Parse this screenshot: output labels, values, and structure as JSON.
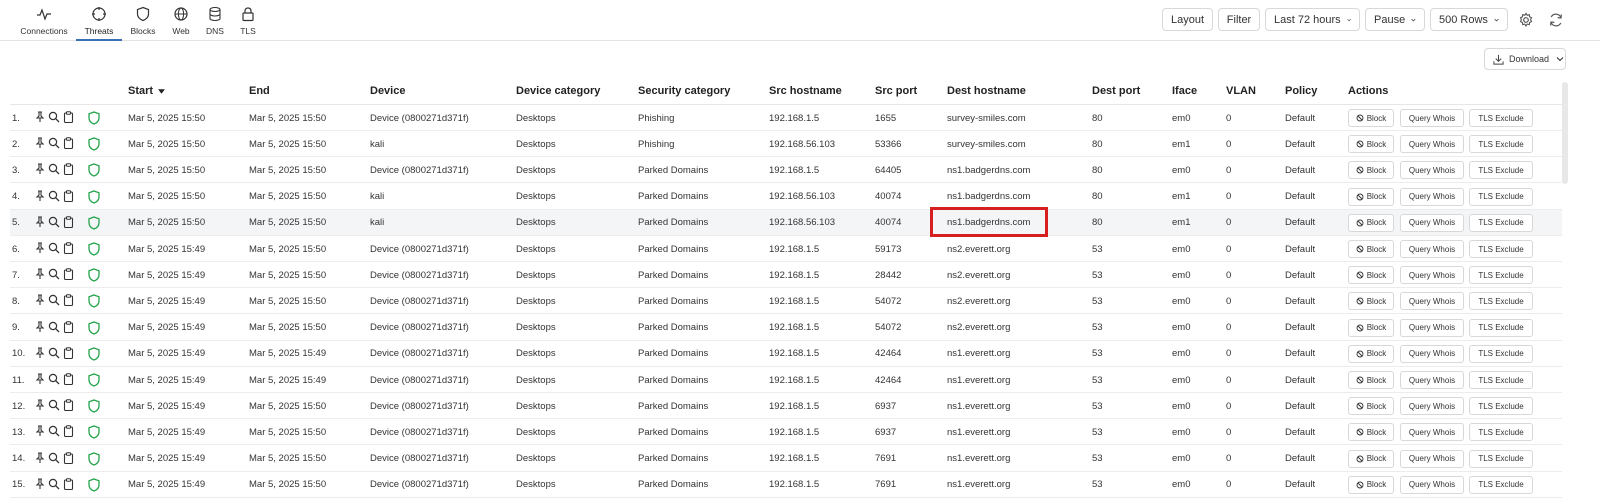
{
  "nav": {
    "tabs": [
      {
        "label": "Connections",
        "icon": "activity-icon"
      },
      {
        "label": "Threats",
        "icon": "crosshair-icon"
      },
      {
        "label": "Blocks",
        "icon": "shield-icon"
      },
      {
        "label": "Web",
        "icon": "globe-icon"
      },
      {
        "label": "DNS",
        "icon": "database-icon"
      },
      {
        "label": "TLS",
        "icon": "lock-icon"
      }
    ],
    "active": "Threats"
  },
  "toolbar": {
    "layout": "Layout",
    "filter": "Filter",
    "range": "Last 72 hours",
    "pause": "Pause",
    "rows": "500 Rows",
    "download": "Download"
  },
  "columns": [
    "Start",
    "End",
    "Device",
    "Device category",
    "Security category",
    "Src hostname",
    "Src port",
    "Dest hostname",
    "Dest port",
    "Iface",
    "VLAN",
    "Policy",
    "Actions"
  ],
  "actions": {
    "block": "Block",
    "whois": "Query Whois",
    "tls": "TLS Exclude"
  },
  "rows": [
    {
      "idx": "1.",
      "start": "Mar 5, 2025 15:50",
      "end": "Mar 5, 2025 15:50",
      "device": "Device (0800271d371f)",
      "devcat": "Desktops",
      "seccat": "Phishing",
      "src": "192.168.1.5",
      "sport": "1655",
      "dest": "survey-smiles.com",
      "dport": "80",
      "iface": "em0",
      "vlan": "0",
      "policy": "Default"
    },
    {
      "idx": "2.",
      "start": "Mar 5, 2025 15:50",
      "end": "Mar 5, 2025 15:50",
      "device": "kali",
      "devcat": "Desktops",
      "seccat": "Phishing",
      "src": "192.168.56.103",
      "sport": "53366",
      "dest": "survey-smiles.com",
      "dport": "80",
      "iface": "em1",
      "vlan": "0",
      "policy": "Default"
    },
    {
      "idx": "3.",
      "start": "Mar 5, 2025 15:50",
      "end": "Mar 5, 2025 15:50",
      "device": "Device (0800271d371f)",
      "devcat": "Desktops",
      "seccat": "Parked Domains",
      "src": "192.168.1.5",
      "sport": "64405",
      "dest": "ns1.badgerdns.com",
      "dport": "80",
      "iface": "em0",
      "vlan": "0",
      "policy": "Default"
    },
    {
      "idx": "4.",
      "start": "Mar 5, 2025 15:50",
      "end": "Mar 5, 2025 15:50",
      "device": "kali",
      "devcat": "Desktops",
      "seccat": "Parked Domains",
      "src": "192.168.56.103",
      "sport": "40074",
      "dest": "ns1.badgerdns.com",
      "dport": "80",
      "iface": "em1",
      "vlan": "0",
      "policy": "Default"
    },
    {
      "idx": "5.",
      "start": "Mar 5, 2025 15:50",
      "end": "Mar 5, 2025 15:50",
      "device": "kali",
      "devcat": "Desktops",
      "seccat": "Parked Domains",
      "src": "192.168.56.103",
      "sport": "40074",
      "dest": "ns1.badgerdns.com",
      "dport": "80",
      "iface": "em1",
      "vlan": "0",
      "policy": "Default"
    },
    {
      "idx": "6.",
      "start": "Mar 5, 2025 15:49",
      "end": "Mar 5, 2025 15:50",
      "device": "Device (0800271d371f)",
      "devcat": "Desktops",
      "seccat": "Parked Domains",
      "src": "192.168.1.5",
      "sport": "59173",
      "dest": "ns2.everett.org",
      "dport": "53",
      "iface": "em0",
      "vlan": "0",
      "policy": "Default"
    },
    {
      "idx": "7.",
      "start": "Mar 5, 2025 15:49",
      "end": "Mar 5, 2025 15:50",
      "device": "Device (0800271d371f)",
      "devcat": "Desktops",
      "seccat": "Parked Domains",
      "src": "192.168.1.5",
      "sport": "28442",
      "dest": "ns2.everett.org",
      "dport": "53",
      "iface": "em0",
      "vlan": "0",
      "policy": "Default"
    },
    {
      "idx": "8.",
      "start": "Mar 5, 2025 15:49",
      "end": "Mar 5, 2025 15:50",
      "device": "Device (0800271d371f)",
      "devcat": "Desktops",
      "seccat": "Parked Domains",
      "src": "192.168.1.5",
      "sport": "54072",
      "dest": "ns2.everett.org",
      "dport": "53",
      "iface": "em0",
      "vlan": "0",
      "policy": "Default"
    },
    {
      "idx": "9.",
      "start": "Mar 5, 2025 15:49",
      "end": "Mar 5, 2025 15:50",
      "device": "Device (0800271d371f)",
      "devcat": "Desktops",
      "seccat": "Parked Domains",
      "src": "192.168.1.5",
      "sport": "54072",
      "dest": "ns2.everett.org",
      "dport": "53",
      "iface": "em0",
      "vlan": "0",
      "policy": "Default"
    },
    {
      "idx": "10.",
      "start": "Mar 5, 2025 15:49",
      "end": "Mar 5, 2025 15:49",
      "device": "Device (0800271d371f)",
      "devcat": "Desktops",
      "seccat": "Parked Domains",
      "src": "192.168.1.5",
      "sport": "42464",
      "dest": "ns1.everett.org",
      "dport": "53",
      "iface": "em0",
      "vlan": "0",
      "policy": "Default"
    },
    {
      "idx": "11.",
      "start": "Mar 5, 2025 15:49",
      "end": "Mar 5, 2025 15:49",
      "device": "Device (0800271d371f)",
      "devcat": "Desktops",
      "seccat": "Parked Domains",
      "src": "192.168.1.5",
      "sport": "42464",
      "dest": "ns1.everett.org",
      "dport": "53",
      "iface": "em0",
      "vlan": "0",
      "policy": "Default"
    },
    {
      "idx": "12.",
      "start": "Mar 5, 2025 15:49",
      "end": "Mar 5, 2025 15:50",
      "device": "Device (0800271d371f)",
      "devcat": "Desktops",
      "seccat": "Parked Domains",
      "src": "192.168.1.5",
      "sport": "6937",
      "dest": "ns1.everett.org",
      "dport": "53",
      "iface": "em0",
      "vlan": "0",
      "policy": "Default"
    },
    {
      "idx": "13.",
      "start": "Mar 5, 2025 15:49",
      "end": "Mar 5, 2025 15:50",
      "device": "Device (0800271d371f)",
      "devcat": "Desktops",
      "seccat": "Parked Domains",
      "src": "192.168.1.5",
      "sport": "6937",
      "dest": "ns1.everett.org",
      "dport": "53",
      "iface": "em0",
      "vlan": "0",
      "policy": "Default"
    },
    {
      "idx": "14.",
      "start": "Mar 5, 2025 15:49",
      "end": "Mar 5, 2025 15:50",
      "device": "Device (0800271d371f)",
      "devcat": "Desktops",
      "seccat": "Parked Domains",
      "src": "192.168.1.5",
      "sport": "7691",
      "dest": "ns1.everett.org",
      "dport": "53",
      "iface": "em0",
      "vlan": "0",
      "policy": "Default"
    },
    {
      "idx": "15.",
      "start": "Mar 5, 2025 15:49",
      "end": "Mar 5, 2025 15:50",
      "device": "Device (0800271d371f)",
      "devcat": "Desktops",
      "seccat": "Parked Domains",
      "src": "192.168.1.5",
      "sport": "7691",
      "dest": "ns1.everett.org",
      "dport": "53",
      "iface": "em0",
      "vlan": "0",
      "policy": "Default"
    }
  ],
  "highlighted_row": 5,
  "colors": {
    "accent": "#3b6fb6",
    "shield": "#22a34a",
    "highlight_box": "#d61f1f"
  }
}
